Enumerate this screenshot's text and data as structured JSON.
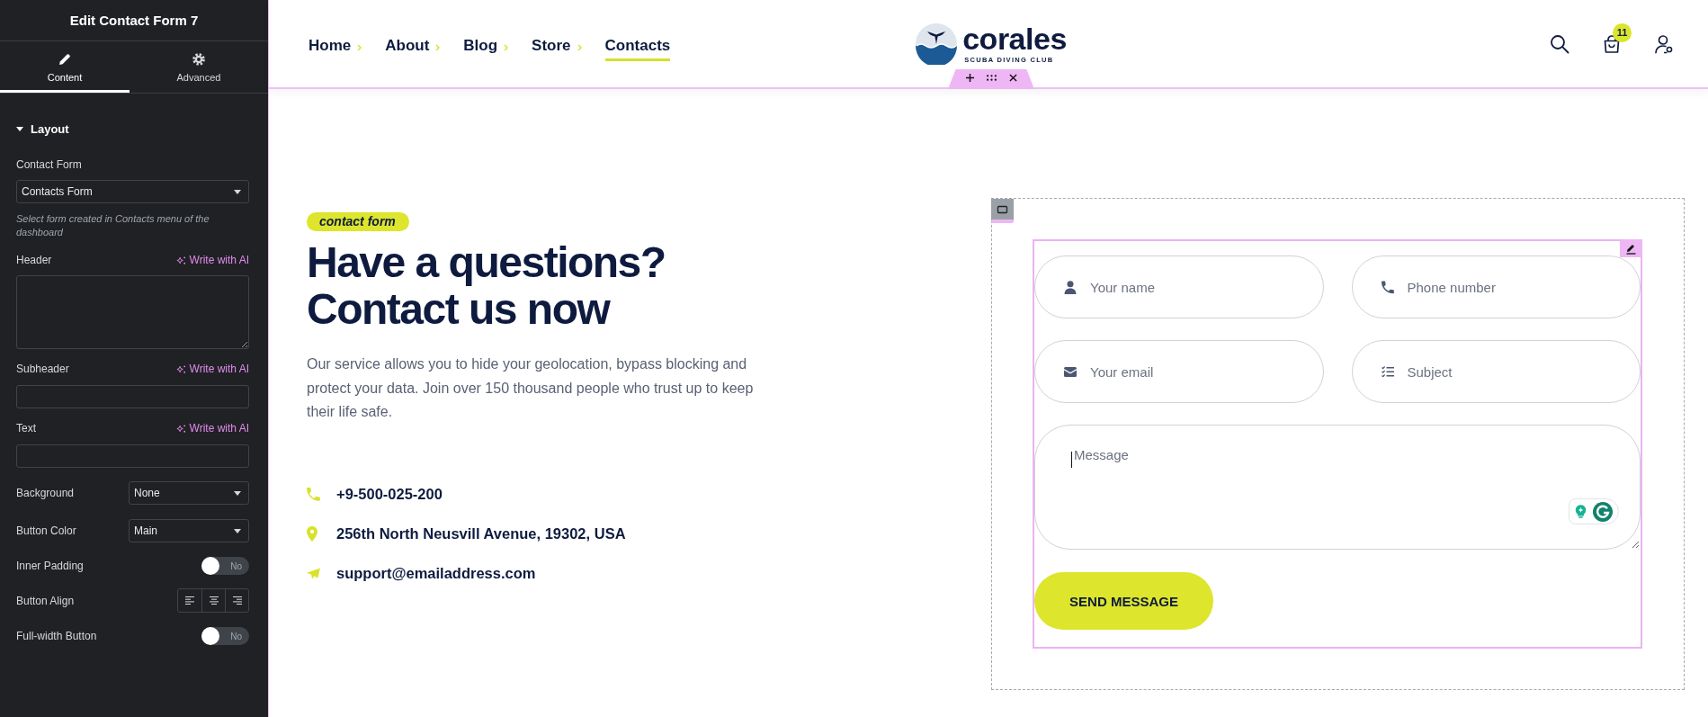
{
  "sidebar": {
    "title": "Edit Contact Form 7",
    "tabs": [
      {
        "label": "Content",
        "selected": true
      },
      {
        "label": "Advanced",
        "selected": false
      }
    ],
    "section": {
      "title": "Layout",
      "expanded": true
    },
    "controls": [
      {
        "kind": "select",
        "label": "Contact Form",
        "value": "Contacts Form",
        "help": "Select form created in Contacts menu of the dashboard"
      },
      {
        "kind": "textarea",
        "label": "Header",
        "ai_link": "Write with AI"
      },
      {
        "kind": "text",
        "label": "Subheader",
        "ai_link": "Write with AI"
      },
      {
        "kind": "text",
        "label": "Text",
        "ai_link": "Write with AI"
      },
      {
        "kind": "inline_select",
        "label": "Background",
        "value": "None"
      },
      {
        "kind": "inline_select",
        "label": "Button Color",
        "value": "Main"
      },
      {
        "kind": "toggle",
        "label": "Inner Padding",
        "on": false,
        "state_text": "No"
      },
      {
        "kind": "align",
        "label": "Button Align",
        "options": [
          {
            "selected": false
          },
          {
            "selected": false
          },
          {
            "selected": false
          }
        ]
      },
      {
        "kind": "toggle",
        "label": "Full-width Button",
        "on": false,
        "state_text": "No"
      }
    ]
  },
  "nav": {
    "items": [
      {
        "label": "Home",
        "has_submenu": true,
        "selected": false
      },
      {
        "label": "About",
        "has_submenu": true,
        "selected": false
      },
      {
        "label": "Blog",
        "has_submenu": true,
        "selected": false
      },
      {
        "label": "Store",
        "has_submenu": true,
        "selected": false
      },
      {
        "label": "Contacts",
        "has_submenu": false,
        "selected": true
      }
    ]
  },
  "logo": {
    "name": "corales",
    "tagline": "SCUBA DIVING CLUB"
  },
  "cart": {
    "badge": "11"
  },
  "hero": {
    "tag": "contact form",
    "heading": "Have a questions? Contact us now",
    "text": "Our service allows you to hide your geolocation, bypass blocking and protect your data. Join over 150 thousand people who trust up to keep their life safe.",
    "contacts": [
      {
        "kind": "phone",
        "text": "+9-500-025-200"
      },
      {
        "kind": "address",
        "text": "256th North Neusvill Avenue, 19302, USA"
      },
      {
        "kind": "email",
        "text": "support@emailaddress.com"
      }
    ]
  },
  "form": {
    "fields": [
      {
        "kind": "name",
        "placeholder": "Your name"
      },
      {
        "kind": "phone",
        "placeholder": "Phone number"
      },
      {
        "kind": "email",
        "placeholder": "Your email"
      },
      {
        "kind": "subject",
        "placeholder": "Subject"
      }
    ],
    "message": {
      "placeholder": "Message",
      "focused": true
    },
    "submit": "SEND MESSAGE"
  }
}
